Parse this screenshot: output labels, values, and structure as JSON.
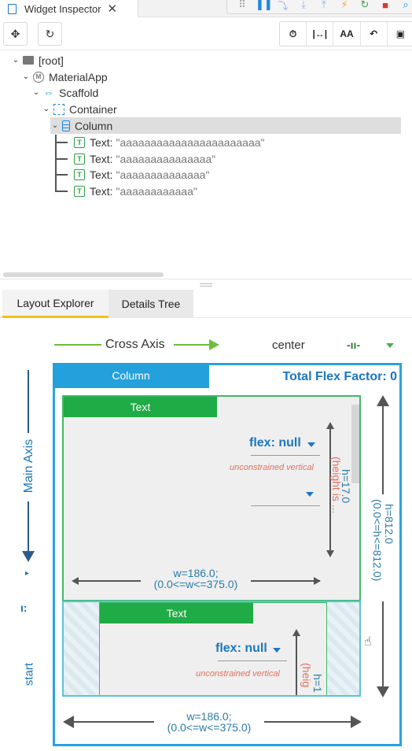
{
  "tab": {
    "title": "Widget Inspector",
    "close": "✕"
  },
  "debug_icons": [
    "⠿",
    "❚❚",
    "⤵",
    "⤓",
    "⤒",
    "⚡",
    "↻",
    "■",
    "⌕"
  ],
  "toolbar": {
    "select_icon": "✥",
    "refresh_icon": "↻",
    "group": [
      "⏱",
      "|↔|",
      "AA",
      "↶",
      "▣"
    ]
  },
  "tree": {
    "root": "[root]",
    "app": "MaterialApp",
    "app_badge": "M",
    "scaffold": "Scaffold",
    "container": "Container",
    "column": "Column",
    "texts": [
      {
        "label": "Text:",
        "value": "\"aaaaaaaaaaaaaaaaaaaaaaa\""
      },
      {
        "label": "Text:",
        "value": "\"aaaaaaaaaaaaaaa\""
      },
      {
        "label": "Text:",
        "value": "\"aaaaaaaaaaaaaa\""
      },
      {
        "label": "Text:",
        "value": "\"aaaaaaaaaaaa\""
      }
    ]
  },
  "panel_tabs": {
    "layout_explorer": "Layout Explorer",
    "details_tree": "Details Tree"
  },
  "layout": {
    "cross_axis": "Cross Axis",
    "cross_alignment": "center",
    "main_axis": "Main Axis",
    "main_alignment": "start",
    "column_label": "Column",
    "total_flex": "Total Flex Factor: 0",
    "child1": {
      "label": "Text",
      "flex": "flex: null",
      "unconstrained": "unconstrained vertical",
      "height": "h=17.0",
      "height_note": "(height is ...",
      "width": "w=186.0;",
      "width_range": "(0.0<=w<=375.0)"
    },
    "child2": {
      "label": "Text",
      "flex": "flex: null",
      "unconstrained": "unconstrained vertical",
      "height": "h=1",
      "height_note": "(heig"
    },
    "outer_height": "h=812.0",
    "outer_height_range": "(0.0<=h<=812.0)",
    "outer_width": "w=186.0;",
    "outer_width_range": "(0.0<=w<=375.0)"
  },
  "colors": {
    "accent": "#1a76c2",
    "column_blue": "#24a0dc",
    "text_green": "#1fab45",
    "tab_active": "#f2c21b"
  }
}
